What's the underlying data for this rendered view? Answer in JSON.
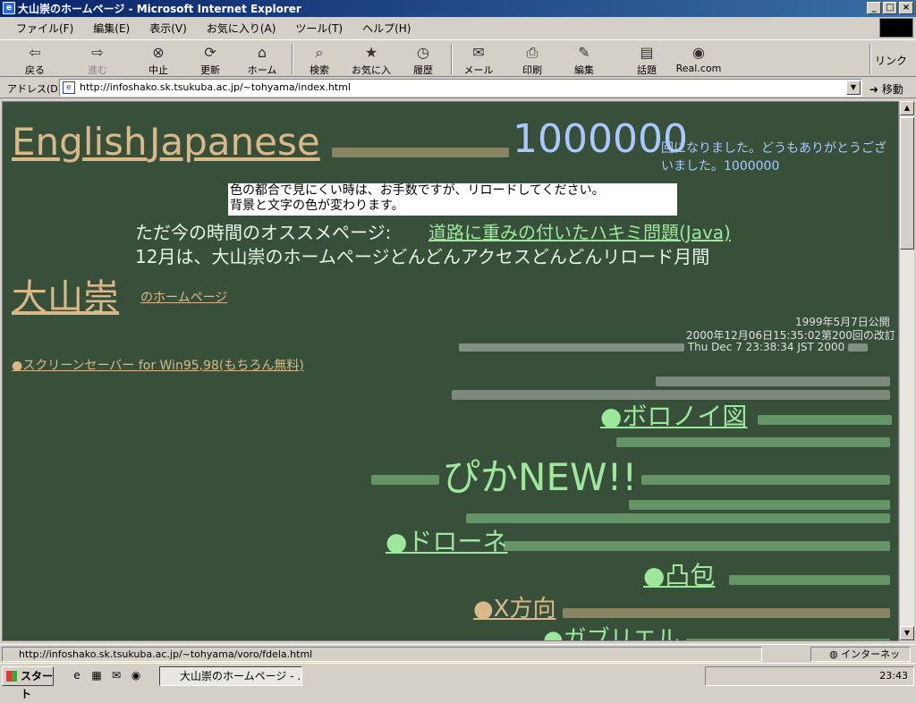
{
  "window": {
    "title": "大山崇のホームページ - Microsoft Internet Explorer"
  },
  "menu": [
    "ファイル(F)",
    "編集(E)",
    "表示(V)",
    "お気に入り(A)",
    "ツール(T)",
    "ヘルプ(H)"
  ],
  "toolbar": {
    "back": "戻る",
    "forward": "進む",
    "stop": "中止",
    "refresh": "更新",
    "home": "ホーム",
    "search": "検索",
    "favorites": "お気に入り",
    "history": "履歴",
    "mail": "メール",
    "print": "印刷",
    "edit": "編集",
    "discuss": "話題",
    "real": "Real.com",
    "links": "リンク"
  },
  "address": {
    "label": "アドレス(D)",
    "url": "http://infoshako.sk.tsukuba.ac.jp/~tohyama/index.html",
    "go": "移動"
  },
  "page": {
    "english": "English",
    "japanese": "Japanese",
    "counter": "1000000",
    "counter_suffix": "回になりました。どうもありがとうございました。1000000",
    "notice_line1": "色の都合で見にくい時は、お手数ですが、リロードしてください。",
    "notice_line2": "背景と文字の色が変わります。",
    "recommend_label": "ただ今の時間のオススメページ:",
    "recommend_link": "道路に重みの付いたハキミ問題(Java)",
    "december": "12月は、大山崇のホームページどんどんアクセスどんどんリロード月間",
    "owner_name": "大山崇",
    "owner_suffix": "のホームページ",
    "published": "1999年5月7日公開",
    "revision": "2000年12月06日15:35:02第200回の改訂",
    "visit_time": "Thu Dec 7 23:38:34 JST 2000",
    "screensaver": "●スクリーンセーバー for Win95,98(もちろん無料)",
    "voronoi": "●ボロノイ図",
    "pika": "ぴかNEW!!",
    "drone": "●ドローネ",
    "convex": "●凸包",
    "xdir": "●X方向",
    "gabriel": "●ガブリエル"
  },
  "status": {
    "url": "http://infoshako.sk.tsukuba.ac.jp/~tohyama/voro/fdela.html",
    "zone": "インターネット"
  },
  "taskbar": {
    "start": "スタート",
    "task": "大山崇のホームページ - ...",
    "clock": "23:43"
  },
  "colors": {
    "page_bg": "#38503a",
    "tan": "#d9b98a",
    "link_green": "#9ee89e"
  }
}
